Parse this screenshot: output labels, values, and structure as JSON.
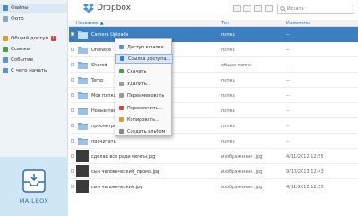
{
  "sidebar": {
    "items": [
      {
        "label": "Файлы",
        "color": "#4f87c6",
        "active": true
      },
      {
        "label": "Фото",
        "color": "#8aa7c7"
      },
      {
        "label": "Общий доступ",
        "color": "#e39a2b",
        "badge": "1"
      },
      {
        "label": "Ссылки",
        "color": "#4a9d4a"
      },
      {
        "label": "Событие",
        "color": "#5e8fd1"
      },
      {
        "label": "С чего начать",
        "color": "#5e8fd1"
      }
    ]
  },
  "mailbox": {
    "label": "MAILBOX",
    "color": "#2e6fa5"
  },
  "header": {
    "title": "Dropbox",
    "search_placeholder": "Искать"
  },
  "table": {
    "columns": {
      "name": "Название",
      "sort_indicator": "▲",
      "type": "Тип",
      "modified": "Изменено"
    },
    "rows": [
      {
        "name": "Camera Uploads",
        "type": "папка",
        "modified": "--",
        "selected": true,
        "icon": "camera-folder-icon"
      },
      {
        "name": "OneNote",
        "type": "папка",
        "modified": "--",
        "icon": "folder-icon"
      },
      {
        "name": "Shared",
        "type": "общая папка",
        "modified": "--",
        "icon": "shared-folder-icon"
      },
      {
        "name": "Temp",
        "type": "папка",
        "modified": "--",
        "icon": "folder-icon"
      },
      {
        "name": "Моя папка",
        "type": "папка",
        "modified": "--",
        "icon": "folder-icon"
      },
      {
        "name": "Новые папки",
        "type": "папка",
        "modified": "--",
        "icon": "folder-icon"
      },
      {
        "name": "просмотреть",
        "type": "папка",
        "modified": "--",
        "icon": "folder-icon"
      },
      {
        "name": "прочитать",
        "type": "папка",
        "modified": "--",
        "icon": "folder-icon"
      },
      {
        "name": "сделай все ради мечты.jpg",
        "type": "изображение .jpg",
        "modified": "4/11/2012 12:55",
        "icon": "image-thumbnail"
      },
      {
        "name": "сын человеческий_промо.jpg",
        "type": "изображение .jpg",
        "modified": "9/10/2013 12:43",
        "icon": "image-thumbnail"
      },
      {
        "name": "сын человеческий.jpg",
        "type": "изображение .jpg",
        "modified": "4/11/2012 12:55",
        "icon": "image-thumbnail"
      }
    ]
  },
  "context_menu": {
    "items": [
      {
        "label": "Доступ к папке...",
        "icon": "share-icon",
        "color": "#5b8fd0"
      },
      {
        "label": "Ссылка доступа...",
        "icon": "link-icon",
        "color": "#3a7dc4",
        "hover": true
      },
      {
        "label": "Скачать",
        "icon": "download-icon",
        "color": "#4a9d4a"
      },
      {
        "label": "Удалить...",
        "icon": "delete-icon",
        "color": "#999999"
      },
      {
        "label": "Переименовать",
        "icon": "rename-icon",
        "color": "#999999"
      },
      {
        "label": "Переместить...",
        "icon": "move-icon",
        "color": "#d9433b"
      },
      {
        "label": "Копировать...",
        "icon": "copy-icon",
        "color": "#e39a2b"
      },
      {
        "label": "Создать альбом",
        "icon": "album-icon",
        "color": "#888888"
      }
    ]
  }
}
